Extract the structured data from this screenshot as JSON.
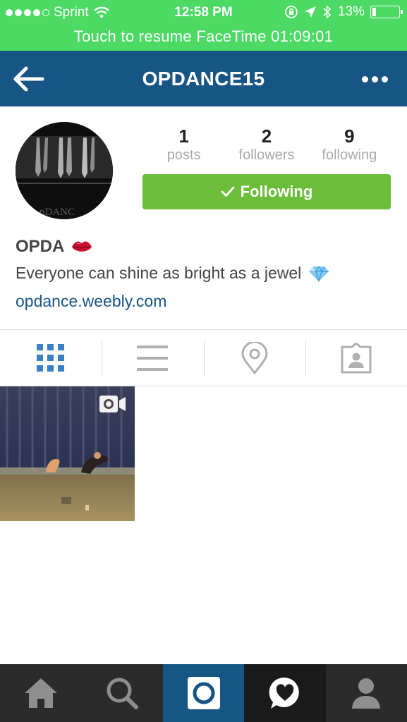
{
  "status_bar": {
    "carrier": "Sprint",
    "time": "12:58 PM",
    "battery": "13%",
    "battery_level": 0.13
  },
  "facetime_banner": "Touch to resume FaceTime 01:09:01",
  "navbar": {
    "title": "OPDANCE15"
  },
  "profile": {
    "avatar_text": "pDANC",
    "stats": [
      {
        "value": "1",
        "label": "posts"
      },
      {
        "value": "2",
        "label": "followers"
      },
      {
        "value": "9",
        "label": "following"
      }
    ],
    "follow_button": "Following",
    "name": "OPDA",
    "bio": "Everyone can shine as bright as a jewel",
    "website": "opdance.weebly.com"
  },
  "tabs": [
    {
      "icon": "grid-icon",
      "active": true
    },
    {
      "icon": "list-icon",
      "active": false
    },
    {
      "icon": "location-pin-icon",
      "active": false
    },
    {
      "icon": "tagged-photos-icon",
      "active": false
    }
  ],
  "posts": [
    {
      "type": "video"
    }
  ],
  "bottom_nav": [
    {
      "icon": "home-icon"
    },
    {
      "icon": "search-icon"
    },
    {
      "icon": "camera-icon"
    },
    {
      "icon": "activity-heart-icon"
    },
    {
      "icon": "profile-icon"
    }
  ],
  "colors": {
    "status_bar": "#4cd964",
    "navbar": "#175584",
    "follow_button": "#6bbd3a",
    "link": "#175584",
    "tab_active": "#3b7fc4",
    "tab_inactive": "#b0b0b0",
    "bottom_bar": "#2b2b2b"
  }
}
